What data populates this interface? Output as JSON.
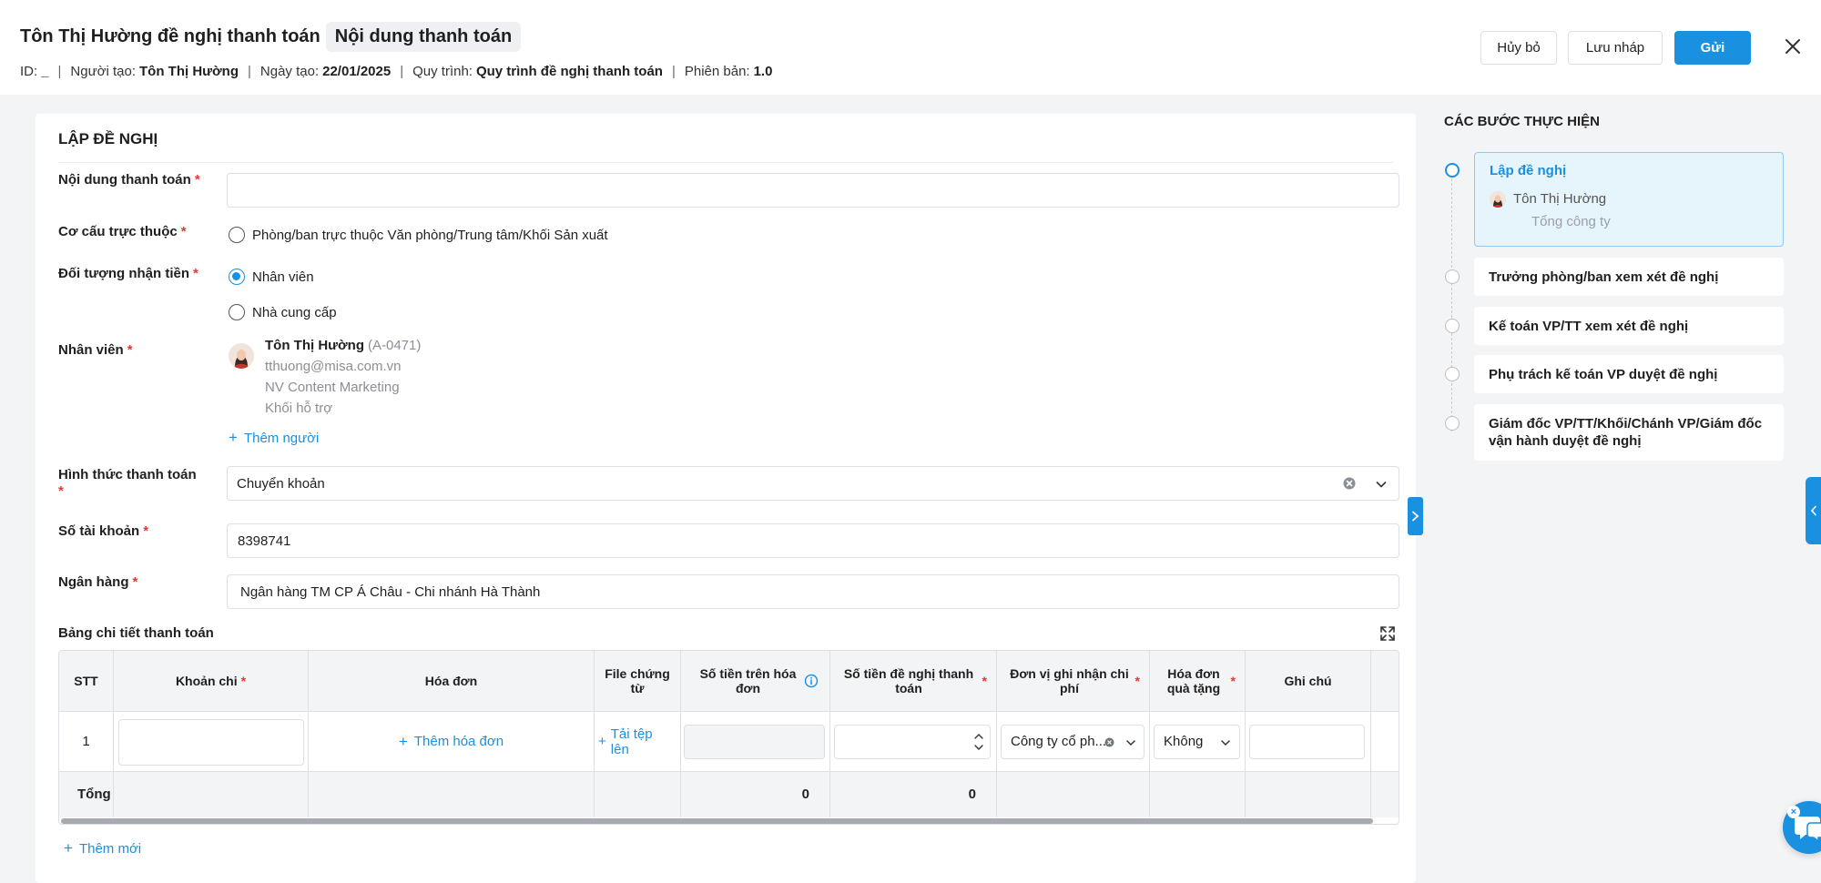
{
  "header": {
    "title": "Tôn Thị Hường đề nghị thanh toán",
    "title_chip": "Nội dung thanh toán",
    "meta": {
      "id_label": "ID:",
      "id_value": "_",
      "creator_label": "Người tạo:",
      "creator_value": "Tôn Thị Hường",
      "date_label": "Ngày tạo:",
      "date_value": "22/01/2025",
      "process_label": "Quy trình:",
      "process_value": "Quy trình đề nghị thanh toán",
      "version_label": "Phiên bản:",
      "version_value": "1.0",
      "separator": "|"
    },
    "buttons": {
      "cancel": "Hủy bỏ",
      "draft": "Lưu nháp",
      "send": "Gửi"
    }
  },
  "form": {
    "section_title": "LẬP ĐỀ NGHỊ",
    "required_mark": "*",
    "payment_content": {
      "label": "Nội dung thanh toán",
      "value": ""
    },
    "structure": {
      "label": "Cơ cấu trực thuộc",
      "option": "Phòng/ban trực thuộc Văn phòng/Trung tâm/Khối Sản xuất"
    },
    "recipient": {
      "label": "Đối tượng nhận tiền",
      "options": [
        "Nhân viên",
        "Nhà cung cấp"
      ],
      "selected": "Nhân viên"
    },
    "employee": {
      "label": "Nhân viên",
      "name": "Tôn Thị Hường",
      "code": "(A-0471)",
      "email": "tthuong@misa.com.vn",
      "position": "NV Content Marketing",
      "unit": "Khối hỗ trợ",
      "add_person": "Thêm người"
    },
    "payment_method": {
      "label": "Hình thức thanh toán",
      "value": "Chuyển khoản"
    },
    "account_number": {
      "label": "Số tài khoản",
      "value": "8398741"
    },
    "bank": {
      "label": "Ngân hàng",
      "value": "Ngân hàng TM CP Á Châu - Chi nhánh Hà Thành"
    },
    "table": {
      "title": "Bảng chi tiết thanh toán",
      "columns": {
        "stt": "STT",
        "expense": "Khoản chi",
        "invoice": "Hóa đơn",
        "file": "File chứng từ",
        "invoice_amount": "Số tiền trên hóa đơn",
        "request_amount": "Số tiền đề nghị thanh toán",
        "cost_unit": "Đơn vị ghi nhận chi phí",
        "gift_invoice": "Hóa đơn quà tặng",
        "note": "Ghi chú"
      },
      "row": {
        "stt": "1",
        "add_invoice": "Thêm hóa đơn",
        "upload": "Tải tệp lên",
        "cost_unit": "Công ty cổ ph...",
        "gift_invoice": "Không"
      },
      "total": {
        "label": "Tổng",
        "invoice_amount": "0",
        "request_amount": "0"
      },
      "add_new": "Thêm mới"
    }
  },
  "steps": {
    "title": "CÁC BƯỚC THỰC HIỆN",
    "active": {
      "label": "Lập đề nghị",
      "person": "Tôn Thị Hường",
      "unit": "Tổng công ty"
    },
    "items": [
      "Trưởng phòng/ban xem xét đề nghị",
      "Kế toán VP/TT xem xét đề nghị",
      "Phụ trách kế toán VP duyệt đề nghị",
      "Giám đốc VP/TT/Khối/Chánh VP/Giám đốc vận hành duyệt đề nghị"
    ]
  },
  "colors": {
    "accent": "#1a90e0",
    "required": "#e53935",
    "muted": "#8a8f96"
  }
}
